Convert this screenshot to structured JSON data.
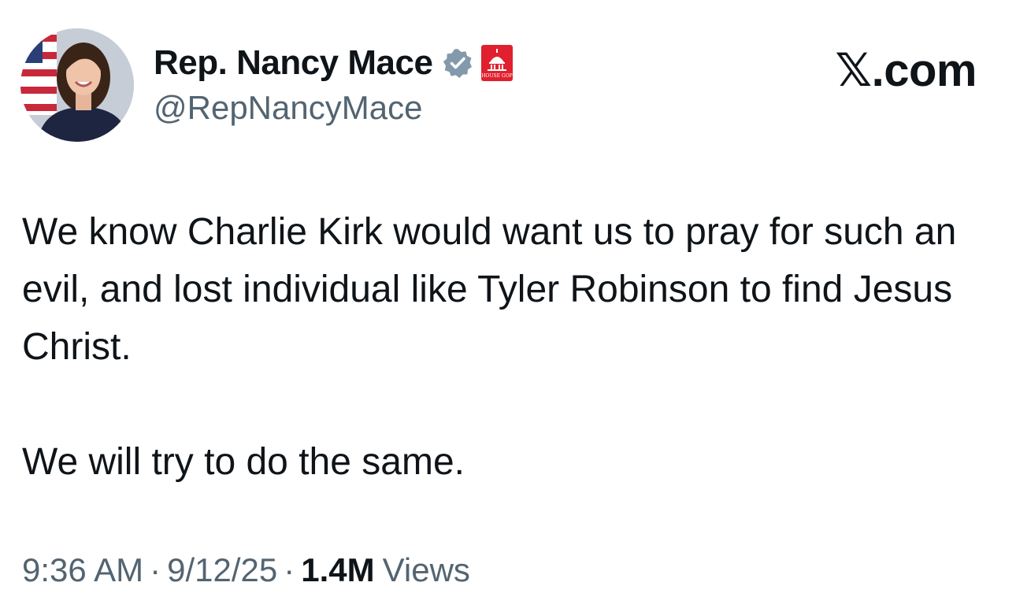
{
  "author": {
    "display_name": "Rep. Nancy Mace",
    "handle": "@RepNancyMace",
    "verified_icon": "verified-badge-icon",
    "affiliation_badge": {
      "icon": "capitol-dome-icon",
      "text": "HOUSE GOP"
    }
  },
  "site": {
    "logo_text": "𝕏.com"
  },
  "tweet": {
    "paragraphs": [
      "We know Charlie Kirk would want us to pray for such an evil, and lost individual like Tyler Robinson to find Jesus Christ.",
      "We will try to do the same."
    ]
  },
  "meta": {
    "time": "9:36 AM",
    "date": "9/12/25",
    "separator": "·",
    "views_count": "1.4M",
    "views_label": "Views"
  },
  "colors": {
    "text_primary": "#0f1419",
    "text_secondary": "#536471",
    "verified_badge": "#829aab",
    "affiliation_red": "#e0202e"
  }
}
